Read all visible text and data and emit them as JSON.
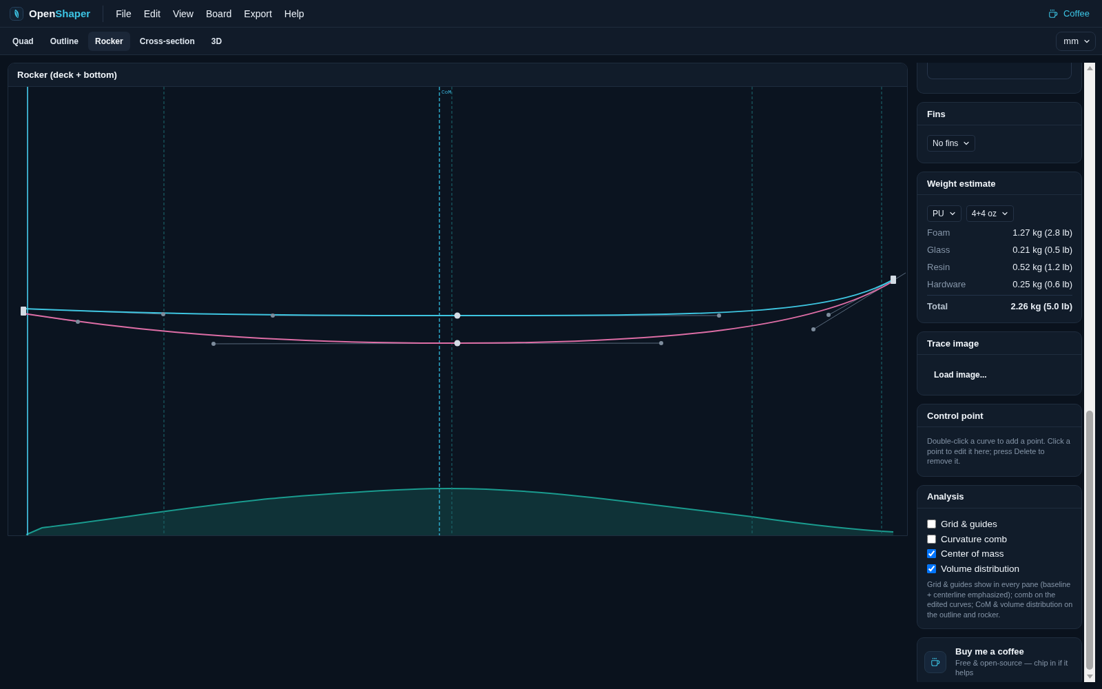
{
  "app_bar": {
    "app_name": {
      "first": "Open",
      "second": "Shaper"
    },
    "menu": [
      "File",
      "Edit",
      "View",
      "Board",
      "Export",
      "Help"
    ],
    "coffee_link": "Coffee"
  },
  "view_tabs": [
    {
      "label": "Quad",
      "selected": false
    },
    {
      "label": "Outline",
      "selected": false
    },
    {
      "label": "Rocker",
      "selected": true
    },
    {
      "label": "Cross-section",
      "selected": false
    },
    {
      "label": "3D",
      "selected": false
    }
  ],
  "units_select": {
    "value": "mm"
  },
  "rocker_pane": {
    "title": "Rocker (deck + bottom)",
    "com_label": "CoM"
  },
  "sidebar": {
    "fins": {
      "title": "Fins",
      "select": "No fins"
    },
    "weight_estimate": {
      "title": "Weight estimate",
      "selects": [
        "PU",
        "4+4 oz"
      ],
      "rows": [
        {
          "label": "Foam",
          "value": "1.27 kg (2.8 lb)"
        },
        {
          "label": "Glass",
          "value": "0.21 kg (0.5 lb)"
        },
        {
          "label": "Resin",
          "value": "0.52 kg (1.2 lb)"
        },
        {
          "label": "Hardware",
          "value": "0.25 kg (0.6 lb)"
        }
      ],
      "total": {
        "label": "Total",
        "value": "2.26 kg (5.0 lb)"
      }
    },
    "trace_image": {
      "title": "Trace image",
      "button": "Load image..."
    },
    "control_point": {
      "title": "Control point",
      "hint": "Double-click a curve to add a point. Click a point to edit it here; press Delete to remove it."
    },
    "analysis": {
      "title": "Analysis",
      "options": [
        {
          "label": "Grid & guides",
          "checked": false
        },
        {
          "label": "Curvature comb",
          "checked": false
        },
        {
          "label": "Center of mass",
          "checked": true
        },
        {
          "label": "Volume distribution",
          "checked": true
        }
      ],
      "note": "Grid & guides show in every pane (baseline + centerline emphasized); comb on the edited curves; CoM & volume distribution on the outline and rocker."
    },
    "coffee_card": {
      "title": "Buy me a coffee",
      "text": "Free & open-source — chip in if it helps"
    }
  }
}
